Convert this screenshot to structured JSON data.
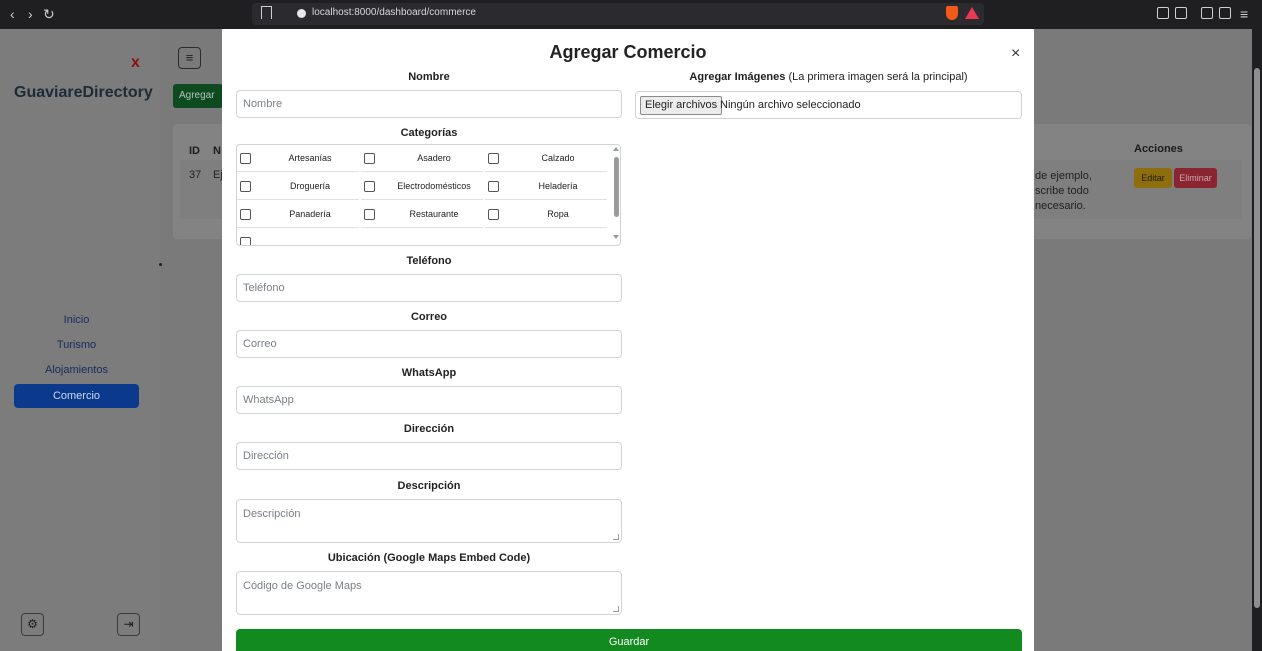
{
  "browser": {
    "url": "localhost:8000/dashboard/commerce"
  },
  "sidebar": {
    "close": "x",
    "brand": "GuaviareDirectory",
    "items": [
      {
        "label": "Inicio"
      },
      {
        "label": "Turismo"
      },
      {
        "label": "Alojamientos"
      },
      {
        "label": "Comercio",
        "active": true
      }
    ]
  },
  "main": {
    "add_button": "Agregar Comercio",
    "table": {
      "headers": {
        "id": "ID",
        "n": "N",
        "actions": "Acciones"
      },
      "row": {
        "id": "37",
        "name_fragment": "Ej",
        "desc_lines": [
          "de ejemplo,",
          "scribe todo",
          "necesario."
        ],
        "edit": "Editar",
        "delete": "Eliminar"
      }
    }
  },
  "modal": {
    "title": "Agregar Comercio",
    "close": "×",
    "nombre": {
      "label": "Nombre",
      "placeholder": "Nombre"
    },
    "categorias": {
      "label": "Categorías",
      "options": [
        "Artesanías",
        "Asadero",
        "Calzado",
        "Droguería",
        "Electrodomésticos",
        "Heladería",
        "Panadería",
        "Restaurante",
        "Ropa"
      ]
    },
    "telefono": {
      "label": "Teléfono",
      "placeholder": "Teléfono"
    },
    "correo": {
      "label": "Correo",
      "placeholder": "Correo"
    },
    "whatsapp": {
      "label": "WhatsApp",
      "placeholder": "WhatsApp"
    },
    "direccion": {
      "label": "Dirección",
      "placeholder": "Dirección"
    },
    "descripcion": {
      "label": "Descripción",
      "placeholder": "Descripción"
    },
    "ubicacion": {
      "label": "Ubicación (Google Maps Embed Code)",
      "placeholder": "Código de Google Maps"
    },
    "imagenes": {
      "label_bold": "Agregar Imágenes",
      "label_note": "(La primera imagen será la principal)",
      "button": "Elegir archivos",
      "status": "Ningún archivo seleccionado"
    },
    "save": "Guardar"
  }
}
